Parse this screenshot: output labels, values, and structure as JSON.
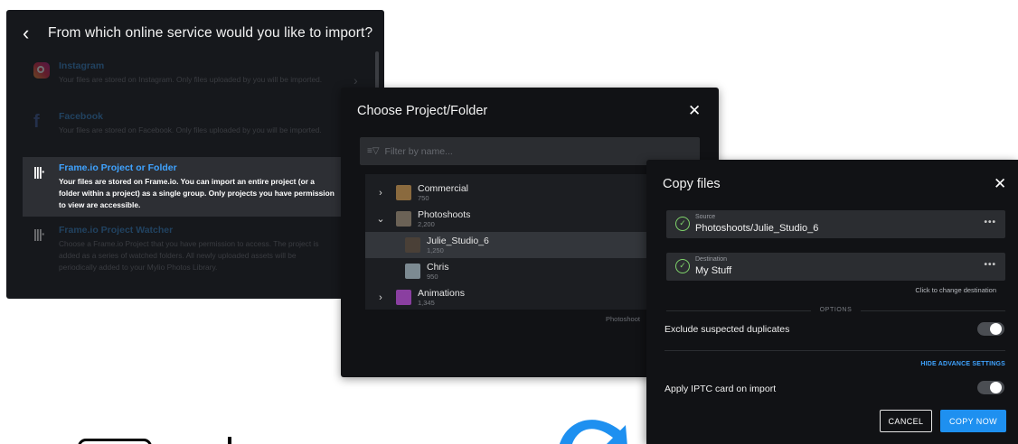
{
  "service_panel": {
    "title": "From which online service would you like to import?",
    "services": [
      {
        "name": "Instagram",
        "desc": "Your files are stored on Instagram. Only files uploaded by you will be imported.",
        "icon": "instagram-icon"
      },
      {
        "name": "Facebook",
        "desc": "Your files are stored on Facebook. Only files uploaded by you will be imported.",
        "icon": "facebook-icon"
      },
      {
        "name": "Frame.io Project or Folder",
        "desc": "Your files are stored on Frame.io. You can import an entire project (or a folder within a project) as a single group. Only projects you have permission to view are accessible.",
        "icon": "frameio-icon",
        "selected": true
      },
      {
        "name": "Frame.io Project Watcher",
        "desc": "Choose a Frame.io Project that you have permission to access. The project is added as a series of watched folders. All newly uploaded assets will be periodically added to your Mylio Photos Library.",
        "icon": "frameio-icon"
      }
    ]
  },
  "folder_panel": {
    "title": "Choose Project/Folder",
    "filter_placeholder": "Filter by name...",
    "items": [
      {
        "name": "Commercial",
        "count": "750",
        "expander": "›",
        "thumb": "#8a6a3e"
      },
      {
        "name": "Photoshoots",
        "count": "2,200",
        "expander": "⌄",
        "thumb": "#6b6256"
      },
      {
        "name": "Julie_Studio_6",
        "count": "1,250",
        "expander": "",
        "thumb": "#4a4037",
        "selected": true
      },
      {
        "name": "Chris",
        "count": "950",
        "expander": "",
        "thumb": "#7c8a92"
      },
      {
        "name": "Animations",
        "count": "1,345",
        "expander": "›",
        "thumb": "#8a3fa0"
      }
    ],
    "footer": "Photoshoot"
  },
  "copy_panel": {
    "title": "Copy files",
    "source_label": "Source",
    "source_value": "Photoshoots/Julie_Studio_6",
    "destination_label": "Destination",
    "destination_value": "My Stuff",
    "change_hint": "Click to change destination",
    "options_label": "OPTIONS",
    "exclude_duplicates": "Exclude suspected duplicates",
    "advanced_link": "HIDE ADVANCE SETTINGS",
    "apply_iptc": "Apply IPTC card on import",
    "cancel": "CANCEL",
    "copy_now": "COPY NOW",
    "more": "•••"
  },
  "colors": {
    "accent": "#1e90f0",
    "success": "#7fd36b"
  }
}
